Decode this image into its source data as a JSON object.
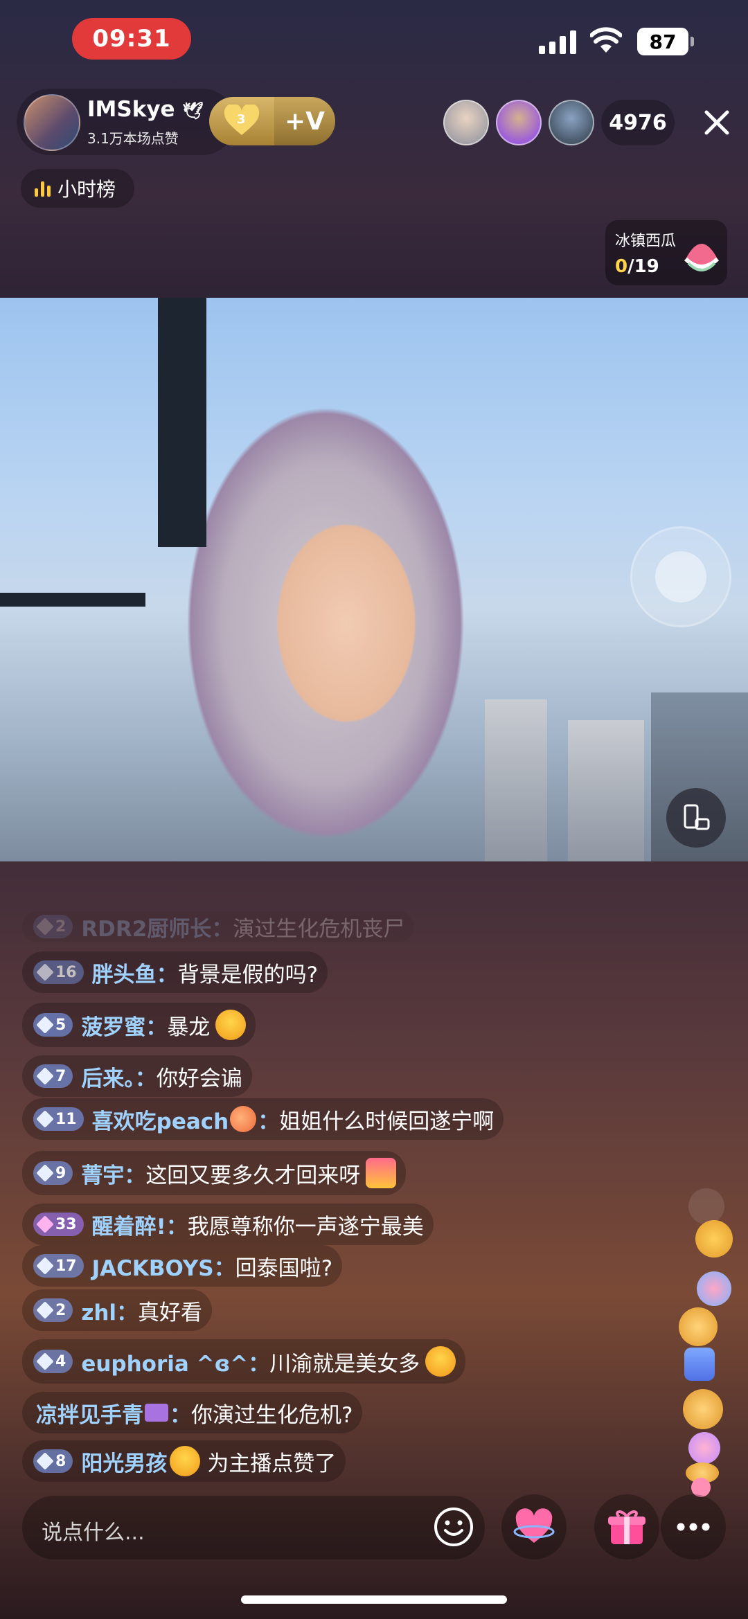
{
  "status_bar": {
    "time": "09:31",
    "battery": "87"
  },
  "host": {
    "name": "IMSkye",
    "likes": "3.1万本场点赞",
    "fan_level": "3",
    "plus_label": "+V"
  },
  "viewers": {
    "count": "4976"
  },
  "rank_label": "小时榜",
  "task": {
    "title": "冰镇西瓜",
    "current": "0",
    "total": "/19"
  },
  "chat": [
    {
      "level": "2",
      "user": "RDR2厨师长：",
      "text": "演过生化危机丧尸"
    },
    {
      "level": "16",
      "user": "胖头鱼：",
      "text": "背景是假的吗?"
    },
    {
      "level": "5",
      "user": "菠罗蜜：",
      "text": "暴龙"
    },
    {
      "level": "7",
      "user": "后来。：",
      "text": "你好会谝"
    },
    {
      "level": "11",
      "user": "喜欢吃peach",
      "user_suffix": "：",
      "text": "姐姐什么时候回遂宁啊"
    },
    {
      "level": "9",
      "user": "菁宇：",
      "text": "这回又要多久才回来呀"
    },
    {
      "level": "33",
      "user": "醒着醉!：",
      "text": "我愿尊称你一声遂宁最美"
    },
    {
      "level": "17",
      "user": "JACKBOYS：",
      "text": "回泰国啦?"
    },
    {
      "level": "2",
      "user": "zhl：",
      "text": "真好看"
    },
    {
      "level": "4",
      "user": "euphoria ^ɞ^：",
      "text": "川渝就是美女多"
    },
    {
      "level": "",
      "user": "凉拌见手青",
      "user_suffix": "：",
      "text": "你演过生化危机?"
    },
    {
      "level": "8",
      "user": "阳光男孩",
      "text": "为主播点赞了"
    }
  ],
  "input": {
    "placeholder": "说点什么..."
  },
  "icons": {
    "smile": "smile-icon",
    "heart": "heart-icon",
    "gift": "gift-icon",
    "more": "more-icon",
    "close": "close-icon",
    "rotate": "rotate-screen-icon"
  },
  "colors": {
    "time_pill": "#e23a3a",
    "username": "#9fd2ff",
    "gold": "#c9a85c"
  }
}
